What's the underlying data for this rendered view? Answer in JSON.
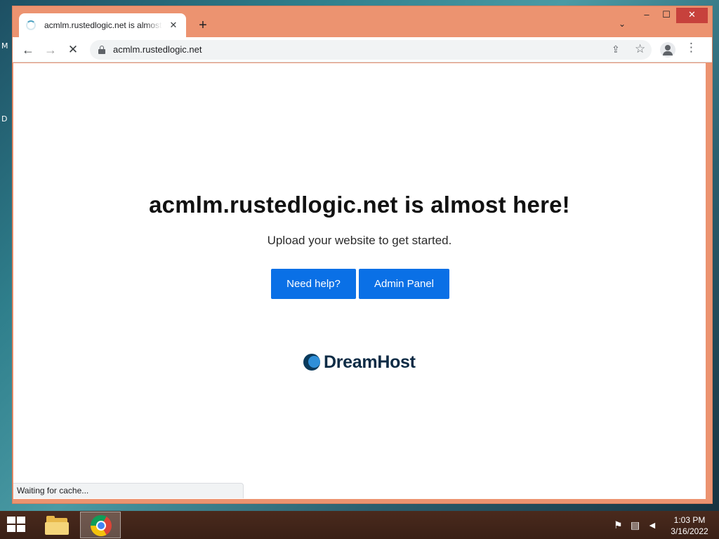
{
  "desktop": {
    "glyph_a": "M",
    "glyph_b": "D"
  },
  "browser": {
    "tab": {
      "title": "acmlm.rustedlogic.net is almost here!",
      "close": "✕"
    },
    "new_tab": "+",
    "tab_search": "⌄",
    "window_controls": {
      "minimize": "–",
      "maximize": "☐",
      "close": "✕"
    },
    "nav": {
      "back": "←",
      "forward": "→",
      "stop": "✕"
    },
    "address": {
      "url": "acmlm.rustedlogic.net"
    },
    "share": "⇪",
    "bookmark": "☆",
    "menu": "⋮",
    "status": "Waiting for cache..."
  },
  "page": {
    "headline": "acmlm.rustedlogic.net is almost here!",
    "subline": "Upload your website to get started.",
    "buttons": {
      "help": "Need help?",
      "admin": "Admin Panel"
    },
    "brand": "DreamHost"
  },
  "taskbar": {
    "clock_time": "1:03 PM",
    "clock_date": "3/16/2022",
    "tray_flag": "⚑",
    "tray_network": "▤",
    "tray_volume": "◄"
  },
  "colors": {
    "window_frame": "#ec9370",
    "button_blue": "#0a70e6",
    "brand_dark": "#0d2b45",
    "close_red": "#c7413c"
  }
}
